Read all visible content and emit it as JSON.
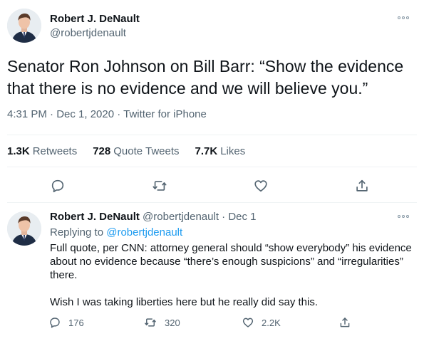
{
  "main_tweet": {
    "author_name": "Robert J. DeNault",
    "author_handle": "@robertjdenault",
    "text": "Senator Ron Johnson on Bill Barr: “Show the evidence that there is no evidence and we will believe you.”",
    "timestamp": "4:31 PM · Dec 1, 2020 · Twitter for iPhone",
    "stats": {
      "retweets_count": "1.3K",
      "retweets_label": "Retweets",
      "quotes_count": "728",
      "quotes_label": "Quote Tweets",
      "likes_count": "7.7K",
      "likes_label": "Likes"
    },
    "actions": [
      "reply-icon",
      "retweet-icon",
      "like-icon",
      "share-icon"
    ]
  },
  "reply_tweet": {
    "author_name": "Robert J. DeNault",
    "author_handle": "@robertjdenault",
    "separator": "·",
    "date": "Dec 1",
    "replying_prefix": "Replying to",
    "replying_handle": "@robertjdenault",
    "paragraph_1": "Full quote, per CNN: attorney general should “show everybody” his evidence about no evidence because “there’s enough suspicions” and “irregularities” there.",
    "paragraph_2": "Wish I was taking liberties here but he really did say this.",
    "counts": {
      "replies": "176",
      "retweets": "320",
      "likes": "2.2K"
    }
  },
  "colors": {
    "text_primary": "#0f1419",
    "text_secondary": "#536471",
    "link": "#1d9bf0",
    "divider": "#eff3f4",
    "icon": "#536471"
  }
}
